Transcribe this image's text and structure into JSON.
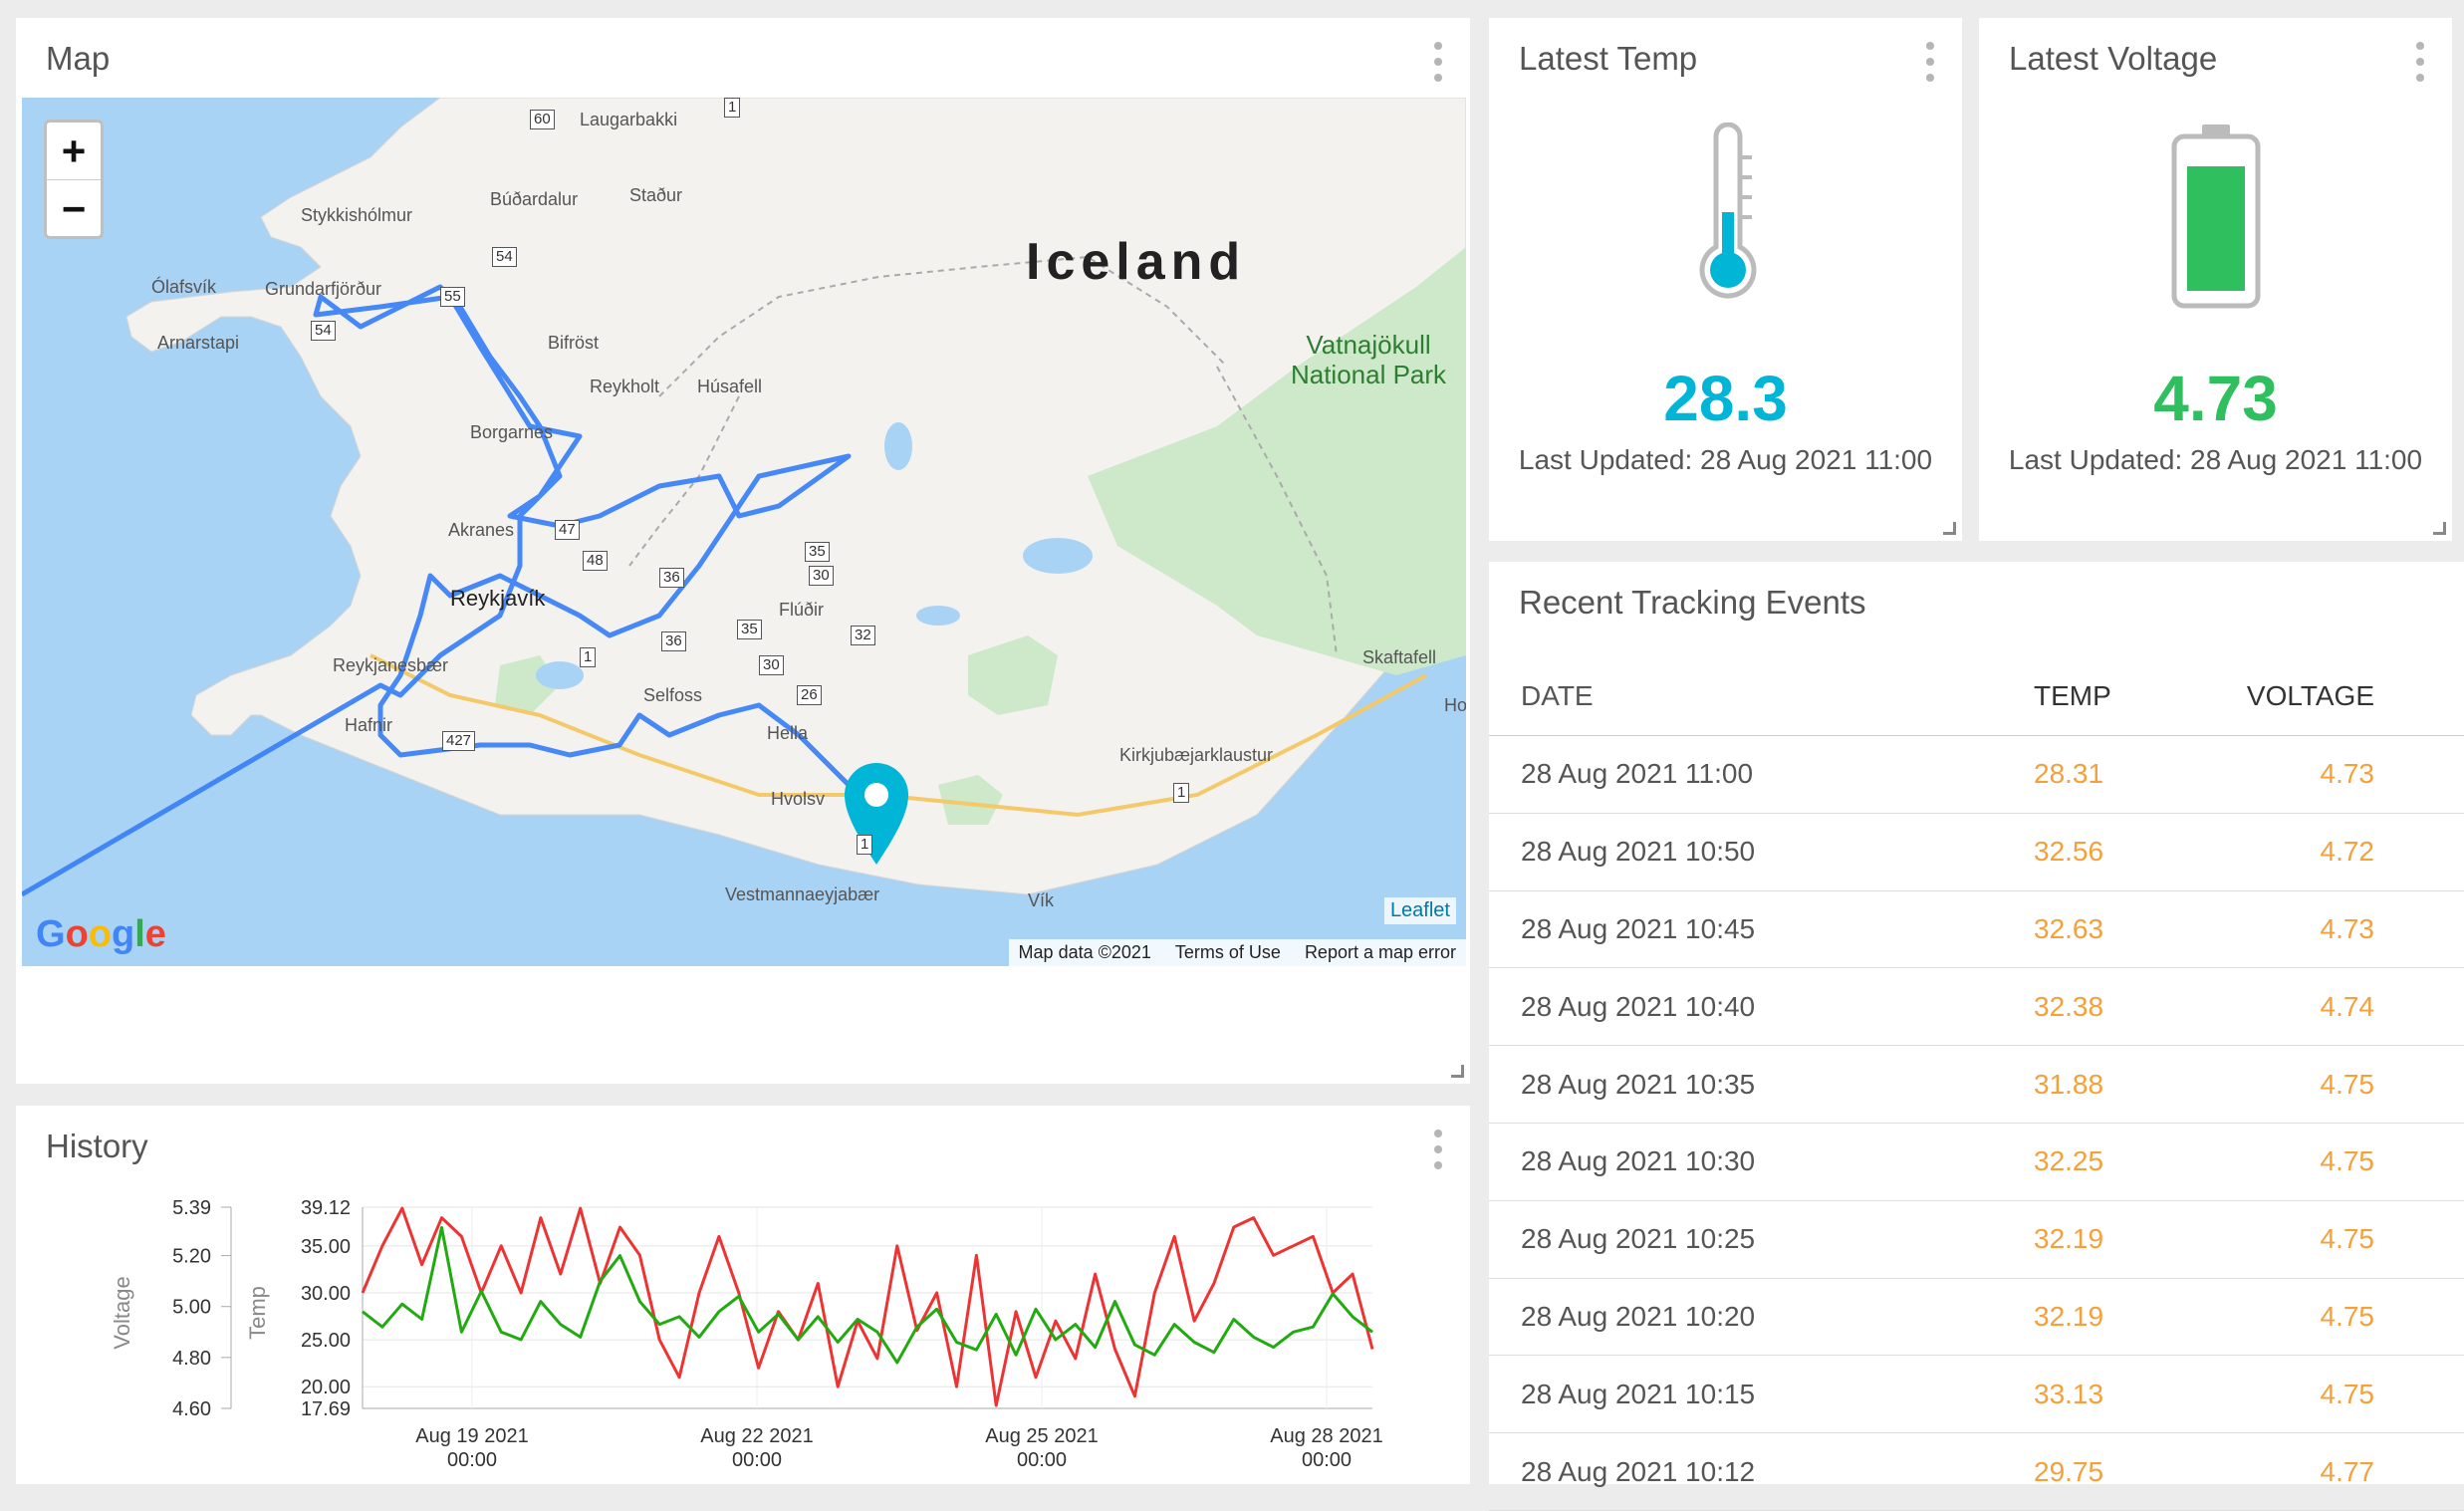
{
  "colors": {
    "accent": "#00b5d6",
    "green": "#2fbf5f",
    "orange": "#f5a03a",
    "route": "#3b82f6",
    "red": "#ee3333",
    "series_green": "#22aa11"
  },
  "map": {
    "title": "Map",
    "zoom_in": "+",
    "zoom_out": "−",
    "country": "Iceland",
    "park": "Vatnajökull National Park",
    "labels": [
      "Laugarbakki",
      "Búðardalur",
      "Staður",
      "Stykkishólmur",
      "Ólafsvík",
      "Grundarfjörður",
      "Arnarstapi",
      "Bifröst",
      "Reykholt",
      "Húsafell",
      "Borgarnes",
      "Akranes",
      "Reykjavík",
      "Reykjanesbær",
      "Hafnir",
      "Flúðir",
      "Selfoss",
      "Hella",
      "Hvolsv",
      "Kirkjubæjarklaustur",
      "Skaftafell",
      "Vestmannaeyjabær",
      "Vík",
      "Ho"
    ],
    "roads": [
      "60",
      "1",
      "54",
      "55",
      "54",
      "47",
      "48",
      "36",
      "35",
      "30",
      "36",
      "35",
      "32",
      "30",
      "26",
      "1",
      "427",
      "1",
      "1"
    ],
    "google": "Google",
    "leaflet": "Leaflet",
    "attribution": [
      "Map data ©2021",
      "Terms of Use",
      "Report a map error"
    ],
    "icons": [
      "zoom-in-icon",
      "zoom-out-icon",
      "map-marker-icon"
    ]
  },
  "temp": {
    "title": "Latest Temp",
    "value": "28.3",
    "updated": "Last Updated: 28 Aug 2021 11:00",
    "icon": "thermometer-icon"
  },
  "voltage": {
    "title": "Latest Voltage",
    "value": "4.73",
    "updated": "Last Updated: 28 Aug 2021 11:00",
    "icon": "battery-icon"
  },
  "events": {
    "title": "Recent Tracking Events",
    "headers": [
      "DATE",
      "TEMP",
      "VOLTAGE"
    ],
    "rows": [
      [
        "28 Aug 2021 11:00",
        "28.31",
        "4.73"
      ],
      [
        "28 Aug 2021 10:50",
        "32.56",
        "4.72"
      ],
      [
        "28 Aug 2021 10:45",
        "32.63",
        "4.73"
      ],
      [
        "28 Aug 2021 10:40",
        "32.38",
        "4.74"
      ],
      [
        "28 Aug 2021 10:35",
        "31.88",
        "4.75"
      ],
      [
        "28 Aug 2021 10:30",
        "32.25",
        "4.75"
      ],
      [
        "28 Aug 2021 10:25",
        "32.19",
        "4.75"
      ],
      [
        "28 Aug 2021 10:20",
        "32.19",
        "4.75"
      ],
      [
        "28 Aug 2021 10:15",
        "33.13",
        "4.75"
      ],
      [
        "28 Aug 2021 10:12",
        "29.75",
        "4.77"
      ]
    ]
  },
  "history": {
    "title": "History"
  },
  "chart_data": {
    "type": "line",
    "xlabel": "",
    "x_ticks": [
      "Aug 19 2021\n00:00",
      "Aug 22 2021\n00:00",
      "Aug 25 2021\n00:00",
      "Aug 28 2021\n00:00"
    ],
    "y_left": {
      "label": "Voltage",
      "ticks": [
        "5.39",
        "5.20",
        "5.00",
        "4.80",
        "4.60"
      ],
      "ylim": [
        4.6,
        5.39
      ]
    },
    "y_right": {
      "label": "Temp",
      "ticks": [
        "39.12",
        "35.00",
        "30.00",
        "25.00",
        "20.00",
        "17.69"
      ],
      "ylim": [
        17.69,
        39.12
      ]
    },
    "grid": true,
    "series": [
      {
        "color": "#ee3333",
        "axis": "temp",
        "values": [
          30,
          35,
          39,
          33,
          38,
          36,
          30,
          35,
          30,
          38,
          32,
          39,
          31,
          37,
          34,
          25,
          21,
          30,
          36,
          30,
          22,
          28,
          25,
          31,
          20,
          27,
          23,
          35,
          26,
          30,
          20,
          34,
          18,
          28,
          21,
          27,
          23,
          32,
          24,
          19,
          30,
          36,
          27,
          31,
          37,
          38,
          34,
          35,
          36,
          30,
          32,
          24
        ]
      },
      {
        "color": "#22aa11",
        "axis": "voltage",
        "values": [
          4.98,
          4.92,
          5.01,
          4.95,
          5.31,
          4.9,
          5.06,
          4.9,
          4.87,
          5.02,
          4.93,
          4.88,
          5.1,
          5.2,
          5.02,
          4.93,
          4.96,
          4.88,
          4.98,
          5.04,
          4.9,
          4.97,
          4.87,
          4.96,
          4.86,
          4.95,
          4.9,
          4.78,
          4.92,
          4.99,
          4.86,
          4.83,
          4.97,
          4.81,
          4.99,
          4.87,
          4.93,
          4.84,
          5.02,
          4.85,
          4.81,
          4.93,
          4.86,
          4.82,
          4.95,
          4.88,
          4.84,
          4.9,
          4.92,
          5.05,
          4.96,
          4.9
        ]
      }
    ]
  }
}
